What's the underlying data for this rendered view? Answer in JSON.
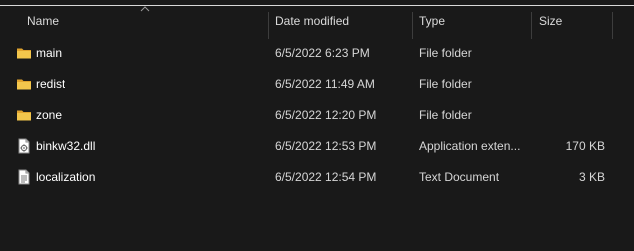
{
  "columns": {
    "name": "Name",
    "date_modified": "Date modified",
    "type": "Type",
    "size": "Size"
  },
  "files": [
    {
      "name": "main",
      "date": "6/5/2022 6:23 PM",
      "type": "File folder",
      "size": "",
      "icon": "folder-icon"
    },
    {
      "name": "redist",
      "date": "6/5/2022 11:49 AM",
      "type": "File folder",
      "size": "",
      "icon": "folder-icon"
    },
    {
      "name": "zone",
      "date": "6/5/2022 12:20 PM",
      "type": "File folder",
      "size": "",
      "icon": "folder-icon"
    },
    {
      "name": "binkw32.dll",
      "date": "6/5/2022 12:53 PM",
      "type": "Application exten...",
      "size": "170 KB",
      "icon": "dll-file-icon"
    },
    {
      "name": "localization",
      "date": "6/5/2022 12:54 PM",
      "type": "Text Document",
      "size": "3 KB",
      "icon": "text-document-icon"
    }
  ],
  "colors": {
    "background": "#191919",
    "folder": "#f3c64c",
    "text": "#ffffff"
  }
}
